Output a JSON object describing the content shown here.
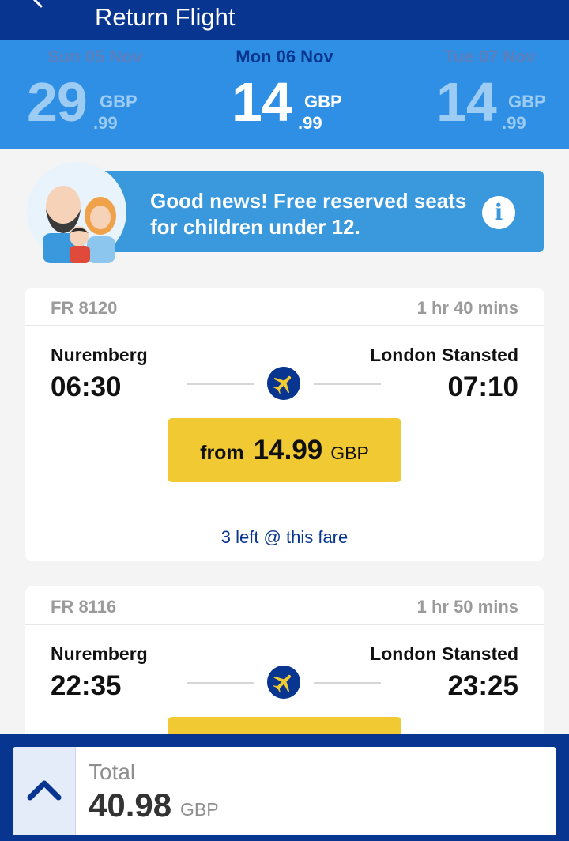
{
  "header": {
    "title": "Return Flight"
  },
  "dates": [
    {
      "label": "Sun 05 Nov",
      "whole": "29",
      "currency": "GBP",
      "cents": ".99",
      "active": false
    },
    {
      "label": "Mon 06 Nov",
      "whole": "14",
      "currency": "GBP",
      "cents": ".99",
      "active": true
    },
    {
      "label": "Tue 07 Nov",
      "whole": "14",
      "currency": "GBP",
      "cents": ".99",
      "active": false
    }
  ],
  "promo": {
    "text": "Good news! Free reserved seats for children under 12."
  },
  "flights": [
    {
      "number": "FR 8120",
      "duration": "1 hr 40 mins",
      "from_city": "Nuremberg",
      "to_city": "London Stansted",
      "depart": "06:30",
      "arrive": "07:10",
      "price_prefix": "from",
      "price": "14.99",
      "currency": "GBP",
      "note": "3 left @ this fare"
    },
    {
      "number": "FR 8116",
      "duration": "1 hr 50 mins",
      "from_city": "Nuremberg",
      "to_city": "London Stansted",
      "depart": "22:35",
      "arrive": "23:25"
    }
  ],
  "total": {
    "label": "Total",
    "amount": "40.98",
    "currency": "GBP"
  },
  "colors": {
    "header": "#073590",
    "date_bar": "#2e8fe4",
    "accent_yellow": "#f1c932",
    "promo": "#3a98dd"
  }
}
